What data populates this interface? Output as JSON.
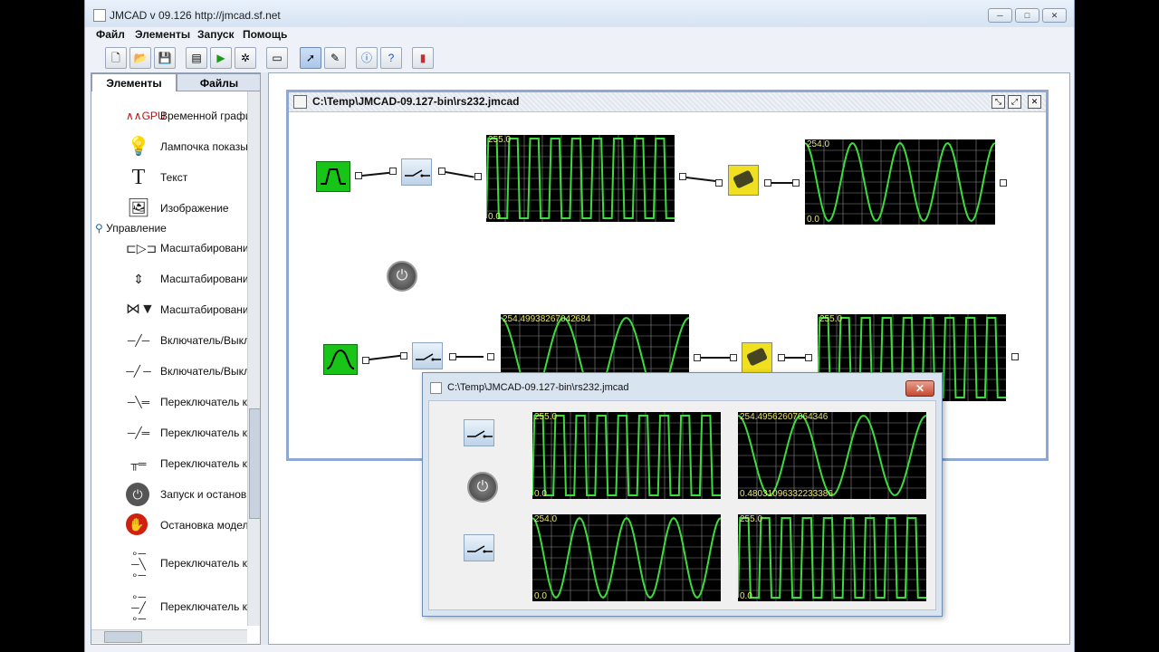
{
  "window": {
    "title": "JMCAD v 09.126 http://jmcad.sf.net",
    "controls": [
      "─",
      "□",
      "✕"
    ]
  },
  "menu": [
    "Файл",
    "Элементы",
    "Запуск",
    "Помощь"
  ],
  "toolbar": {
    "buttons": [
      "new-file",
      "open-file",
      "save-file",
      "properties",
      "run",
      "settings",
      "window",
      "select-pointer",
      "draw-tool",
      "info",
      "help",
      "chart"
    ]
  },
  "sidebar": {
    "tabs": [
      "Элементы",
      "Файлы"
    ],
    "items_top": [
      {
        "icon": "time-chart-gpu-icon",
        "label": "Временной графи"
      },
      {
        "icon": "lamp-icon",
        "label": "Лампочка показы"
      },
      {
        "icon": "text-icon",
        "label": "Текст"
      },
      {
        "icon": "image-icon",
        "label": "Изображение"
      }
    ],
    "group": "Управление",
    "items_control": [
      {
        "icon": "scale-h-icon",
        "label": "Масштабирование"
      },
      {
        "icon": "scale-v-icon",
        "label": "Масштабирование"
      },
      {
        "icon": "scale-valve-icon",
        "label": "Масштабирование"
      },
      {
        "icon": "switch-on-icon",
        "label": "Включатель/Выкл"
      },
      {
        "icon": "switch-off-icon",
        "label": "Включатель/Выкл"
      },
      {
        "icon": "changeover-icon",
        "label": "Переключатель к"
      },
      {
        "icon": "changeover-icon",
        "label": "Переключатель к"
      },
      {
        "icon": "changeover-icon",
        "label": "Переключатель к"
      },
      {
        "icon": "power-icon",
        "label": "Запуск и останов"
      },
      {
        "icon": "stop-icon",
        "label": "Остановка модел"
      },
      {
        "icon": "changeover-3-icon",
        "label": "Переключатель к"
      },
      {
        "icon": "changeover-3-icon",
        "label": "Переключатель к"
      }
    ]
  },
  "model_window": {
    "title": "C:\\Temp\\JMCAD-09.127-bin\\rs232.jmcad",
    "scopes": [
      {
        "max": "255.0",
        "min": "0.0",
        "wave": "square"
      },
      {
        "max": "254.0",
        "min": "0.0",
        "wave": "sine"
      },
      {
        "max": "254.49938267042684",
        "min": "",
        "wave": "sine"
      },
      {
        "max": "255.0",
        "min": "",
        "wave": "square"
      }
    ]
  },
  "run_dialog": {
    "title": "C:\\Temp\\JMCAD-09.127-bin\\rs232.jmcad",
    "close": "✕",
    "scopes": [
      {
        "max": "255.0",
        "min": "0.0",
        "wave": "square"
      },
      {
        "max": "254.49562607064346",
        "min": "0.48031096332233386",
        "wave": "sine"
      },
      {
        "max": "254.0",
        "min": "0.0",
        "wave": "sine"
      },
      {
        "max": "255.0",
        "min": "0.0",
        "wave": "square"
      }
    ]
  },
  "colors": {
    "scope_bg": "#000000",
    "trace": "#3ddc3d",
    "grid": "#8a8a8a",
    "label": "#e8e870",
    "generator": "#18c418"
  }
}
